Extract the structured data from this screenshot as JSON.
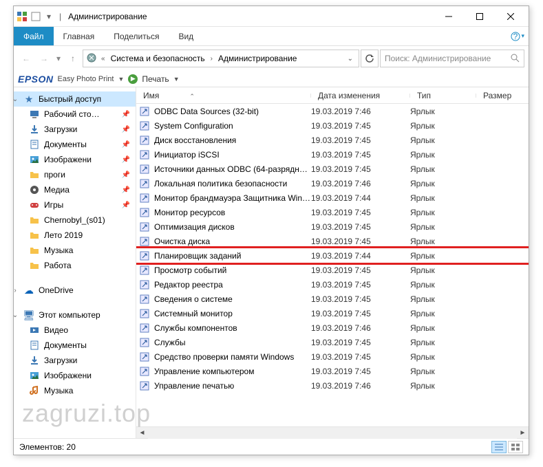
{
  "title": "Администрирование",
  "ribbon": {
    "file": "Файл",
    "home": "Главная",
    "share": "Поделиться",
    "view": "Вид"
  },
  "breadcrumbs": {
    "a": "Система и безопасность",
    "b": "Администрирование"
  },
  "search": {
    "placeholder": "Поиск: Администрирование"
  },
  "epson": {
    "logo": "EPSON",
    "easy": "Easy Photo Print",
    "print": "Печать"
  },
  "cols": {
    "name": "Имя",
    "date": "Дата изменения",
    "type": "Тип",
    "size": "Размер"
  },
  "navpane": {
    "quick": {
      "label": "Быстрый доступ",
      "items": [
        {
          "label": "Рабочий сто…",
          "icon": "desktop",
          "pinned": true
        },
        {
          "label": "Загрузки",
          "icon": "downloads",
          "pinned": true
        },
        {
          "label": "Документы",
          "icon": "documents",
          "pinned": true
        },
        {
          "label": "Изображени",
          "icon": "pictures",
          "pinned": true
        },
        {
          "label": "проги",
          "icon": "folder",
          "pinned": true
        },
        {
          "label": "Медиа",
          "icon": "media",
          "pinned": true
        },
        {
          "label": "Игры",
          "icon": "games",
          "pinned": true
        },
        {
          "label": "Chernobyl_(s01)",
          "icon": "folder",
          "pinned": false
        },
        {
          "label": "Лето 2019",
          "icon": "folder",
          "pinned": false
        },
        {
          "label": "Музыка",
          "icon": "folder",
          "pinned": false
        },
        {
          "label": "Работа",
          "icon": "folder",
          "pinned": false
        }
      ]
    },
    "onedrive": "OneDrive",
    "thispc": {
      "label": "Этот компьютер",
      "items": [
        {
          "label": "Видео",
          "icon": "video"
        },
        {
          "label": "Документы",
          "icon": "documents"
        },
        {
          "label": "Загрузки",
          "icon": "downloads"
        },
        {
          "label": "Изображени",
          "icon": "pictures"
        },
        {
          "label": "Музыка",
          "icon": "music"
        }
      ]
    }
  },
  "files": [
    {
      "name": "ODBC Data Sources (32-bit)",
      "date": "19.03.2019 7:46",
      "type": "Ярлык"
    },
    {
      "name": "System Configuration",
      "date": "19.03.2019 7:45",
      "type": "Ярлык"
    },
    {
      "name": "Диск восстановления",
      "date": "19.03.2019 7:45",
      "type": "Ярлык"
    },
    {
      "name": "Инициатор iSCSI",
      "date": "19.03.2019 7:45",
      "type": "Ярлык"
    },
    {
      "name": "Источники данных ODBC (64-разрядна…",
      "date": "19.03.2019 7:45",
      "type": "Ярлык"
    },
    {
      "name": "Локальная политика безопасности",
      "date": "19.03.2019 7:46",
      "type": "Ярлык"
    },
    {
      "name": "Монитор брандмауэра Защитника Win…",
      "date": "19.03.2019 7:44",
      "type": "Ярлык"
    },
    {
      "name": "Монитор ресурсов",
      "date": "19.03.2019 7:45",
      "type": "Ярлык"
    },
    {
      "name": "Оптимизация дисков",
      "date": "19.03.2019 7:45",
      "type": "Ярлык"
    },
    {
      "name": "Очистка диска",
      "date": "19.03.2019 7:45",
      "type": "Ярлык"
    },
    {
      "name": "Планировщик заданий",
      "date": "19.03.2019 7:44",
      "type": "Ярлык",
      "highlight": true
    },
    {
      "name": "Просмотр событий",
      "date": "19.03.2019 7:45",
      "type": "Ярлык"
    },
    {
      "name": "Редактор реестра",
      "date": "19.03.2019 7:45",
      "type": "Ярлык"
    },
    {
      "name": "Сведения о системе",
      "date": "19.03.2019 7:45",
      "type": "Ярлык"
    },
    {
      "name": "Системный монитор",
      "date": "19.03.2019 7:45",
      "type": "Ярлык"
    },
    {
      "name": "Службы компонентов",
      "date": "19.03.2019 7:46",
      "type": "Ярлык"
    },
    {
      "name": "Службы",
      "date": "19.03.2019 7:45",
      "type": "Ярлык"
    },
    {
      "name": "Средство проверки памяти Windows",
      "date": "19.03.2019 7:45",
      "type": "Ярлык"
    },
    {
      "name": "Управление компьютером",
      "date": "19.03.2019 7:45",
      "type": "Ярлык"
    },
    {
      "name": "Управление печатью",
      "date": "19.03.2019 7:46",
      "type": "Ярлык"
    }
  ],
  "status": {
    "count": "Элементов: 20"
  },
  "watermark": "zagruzi.top"
}
